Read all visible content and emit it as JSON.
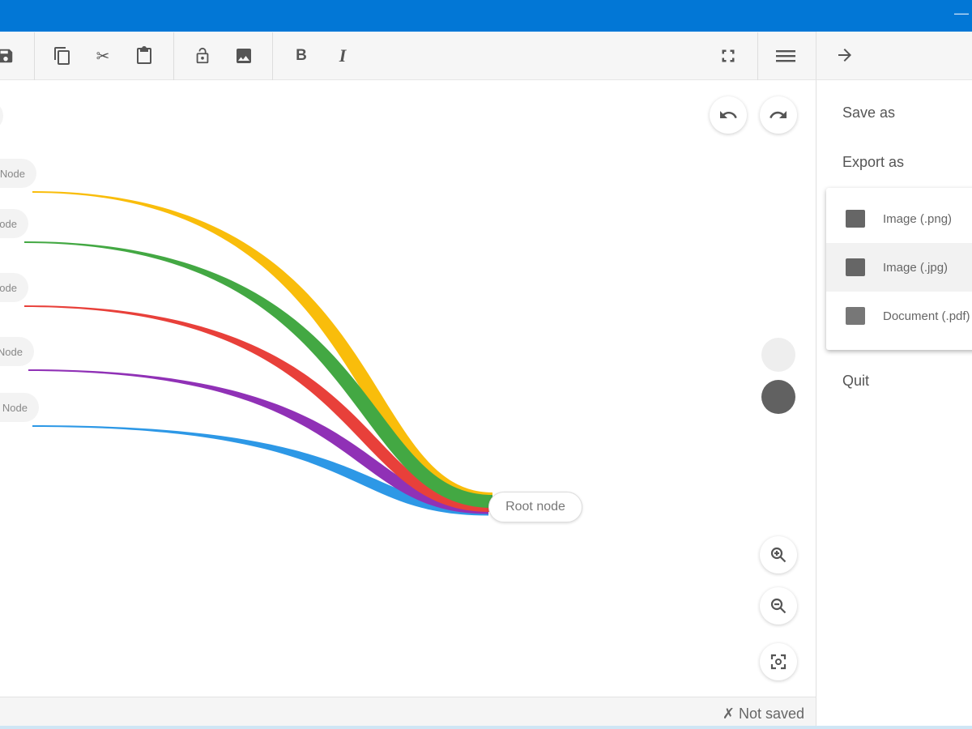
{
  "titlebar": {
    "minimize_icon": "minimize-icon",
    "color": "#0277d6"
  },
  "toolbar": {
    "icons": [
      "save-icon",
      "copy-icon",
      "cut-icon",
      "paste-icon",
      "lock-icon",
      "image-icon",
      "bold-icon",
      "italic-icon",
      "fullscreen-icon",
      "menu-icon"
    ],
    "bold_label": "B",
    "italic_label": "I"
  },
  "panel": {
    "back_icon": "arrow-right-icon",
    "save_as": "Save as",
    "export_as": "Export as",
    "export_options": [
      "Image (.png)",
      "Image (.jpg)",
      "Document (.pdf)"
    ],
    "quit": "Quit"
  },
  "map": {
    "root": "Root node",
    "branches": [
      {
        "label": "Node",
        "color": "#f9bd0b"
      },
      {
        "label": "Node",
        "color": "#43a843"
      },
      {
        "label": "Node",
        "color": "#e8403a"
      },
      {
        "label": "Node",
        "color": "#9031b6"
      },
      {
        "label": "Node",
        "color": "#2d98e6"
      }
    ],
    "colors": [
      "#eeeeee",
      "#616161"
    ]
  },
  "status": {
    "text": "✗ Not saved"
  }
}
